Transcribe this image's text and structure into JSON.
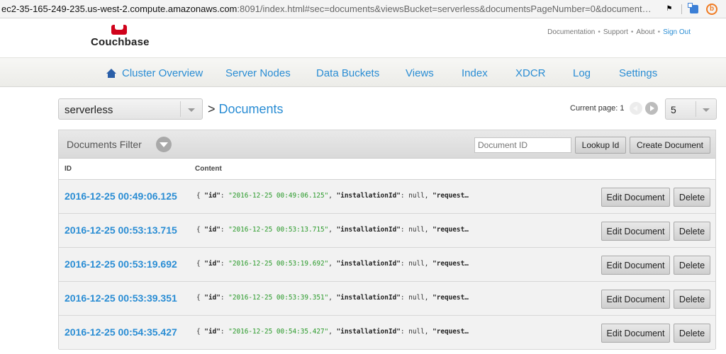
{
  "browser": {
    "url_host": "ec2-35-165-249-235.us-west-2.compute.amazonaws.com",
    "url_rest": ":8091/index.html#sec=documents&viewsBucket=serverless&documentsPageNumber=0&document…"
  },
  "header": {
    "logo_text": "Couchbase",
    "links": {
      "documentation": "Documentation",
      "support": "Support",
      "about": "About",
      "sign_out": "Sign Out",
      "separator": "•"
    }
  },
  "nav": {
    "items": [
      {
        "label": "Cluster Overview"
      },
      {
        "label": "Server Nodes"
      },
      {
        "label": "Data Buckets"
      },
      {
        "label": "Views"
      },
      {
        "label": "Index"
      },
      {
        "label": "XDCR"
      },
      {
        "label": "Log"
      },
      {
        "label": "Settings"
      }
    ]
  },
  "bucket": {
    "selected": "serverless",
    "breadcrumb_sep": ">",
    "breadcrumb_page": "Documents"
  },
  "pager": {
    "current_page_label": "Current page: 1",
    "page_size": "5"
  },
  "filter": {
    "label": "Documents Filter",
    "doc_id_placeholder": "Document ID",
    "lookup_label": "Lookup Id",
    "create_label": "Create Document"
  },
  "table": {
    "col_id": "ID",
    "col_content": "Content",
    "edit_label": "Edit Document",
    "delete_label": "Delete",
    "json_open": "{ ",
    "json_key_id": "\"id\"",
    "json_colon": ": ",
    "json_sep": ", ",
    "json_key_install": "\"installationId\"",
    "json_null": "null",
    "json_key_request": "\"request…",
    "rows": [
      {
        "id": "2016-12-25 00:49:06.125",
        "id_value": "\"2016-12-25 00:49:06.125\""
      },
      {
        "id": "2016-12-25 00:53:13.715",
        "id_value": "\"2016-12-25 00:53:13.715\""
      },
      {
        "id": "2016-12-25 00:53:19.692",
        "id_value": "\"2016-12-25 00:53:19.692\""
      },
      {
        "id": "2016-12-25 00:53:39.351",
        "id_value": "\"2016-12-25 00:53:39.351\""
      },
      {
        "id": "2016-12-25 00:54:35.427",
        "id_value": "\"2016-12-25 00:54:35.427\""
      }
    ]
  },
  "colors": {
    "link_blue": "#2a8dd4",
    "json_green": "#2a9a2a",
    "brand_red": "#d0021b"
  }
}
